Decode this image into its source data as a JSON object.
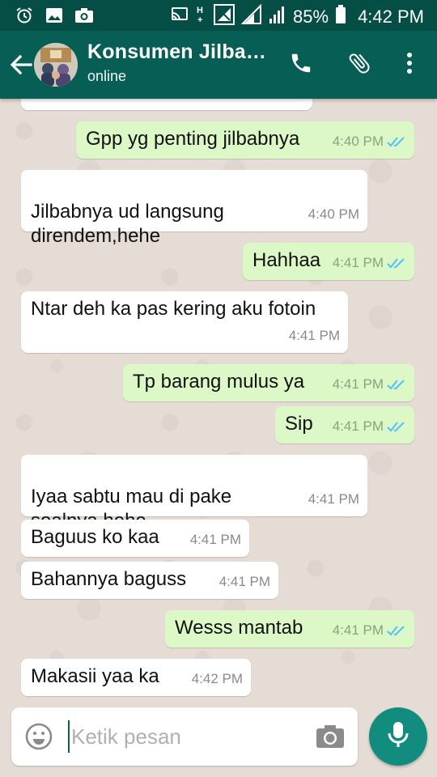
{
  "status_bar": {
    "battery": "85%",
    "time": "4:42 PM"
  },
  "header": {
    "contact_name": "Konsumen Jilbab…",
    "status": "online"
  },
  "messages": [
    {
      "text": "Gpp yg penting jilbabnya",
      "time": "4:40 PM",
      "direction": "out"
    },
    {
      "text": "Jilbabnya ud langsung\ndirendem,hehe",
      "time": "4:40 PM",
      "direction": "in"
    },
    {
      "text": "Hahhaa",
      "time": "4:41 PM",
      "direction": "out"
    },
    {
      "text": "Ntar deh ka pas kering aku fotoin",
      "time": "4:41 PM",
      "direction": "in"
    },
    {
      "text": "Tp barang mulus ya",
      "time": "4:41 PM",
      "direction": "out"
    },
    {
      "text": "Sip",
      "time": "4:41 PM",
      "direction": "out"
    },
    {
      "text": "Iyaa sabtu mau di pake\nsoalnya,hehe",
      "time": "4:41 PM",
      "direction": "in"
    },
    {
      "text": "Baguus ko kaa",
      "time": "4:41 PM",
      "direction": "in"
    },
    {
      "text": "Bahannya baguss",
      "time": "4:41 PM",
      "direction": "in"
    },
    {
      "text": "Wesss mantab",
      "time": "4:41 PM",
      "direction": "out"
    },
    {
      "text": "Makasii yaa ka",
      "time": "4:42 PM",
      "direction": "in"
    }
  ],
  "input": {
    "placeholder": "Ketik pesan",
    "value": ""
  },
  "colors": {
    "header": "#075e54",
    "status_bar": "#044e45",
    "outgoing_bubble": "#dcf8c6",
    "incoming_bubble": "#ffffff",
    "mic_button": "#128c7e",
    "read_ticks": "#4fc3f7"
  }
}
